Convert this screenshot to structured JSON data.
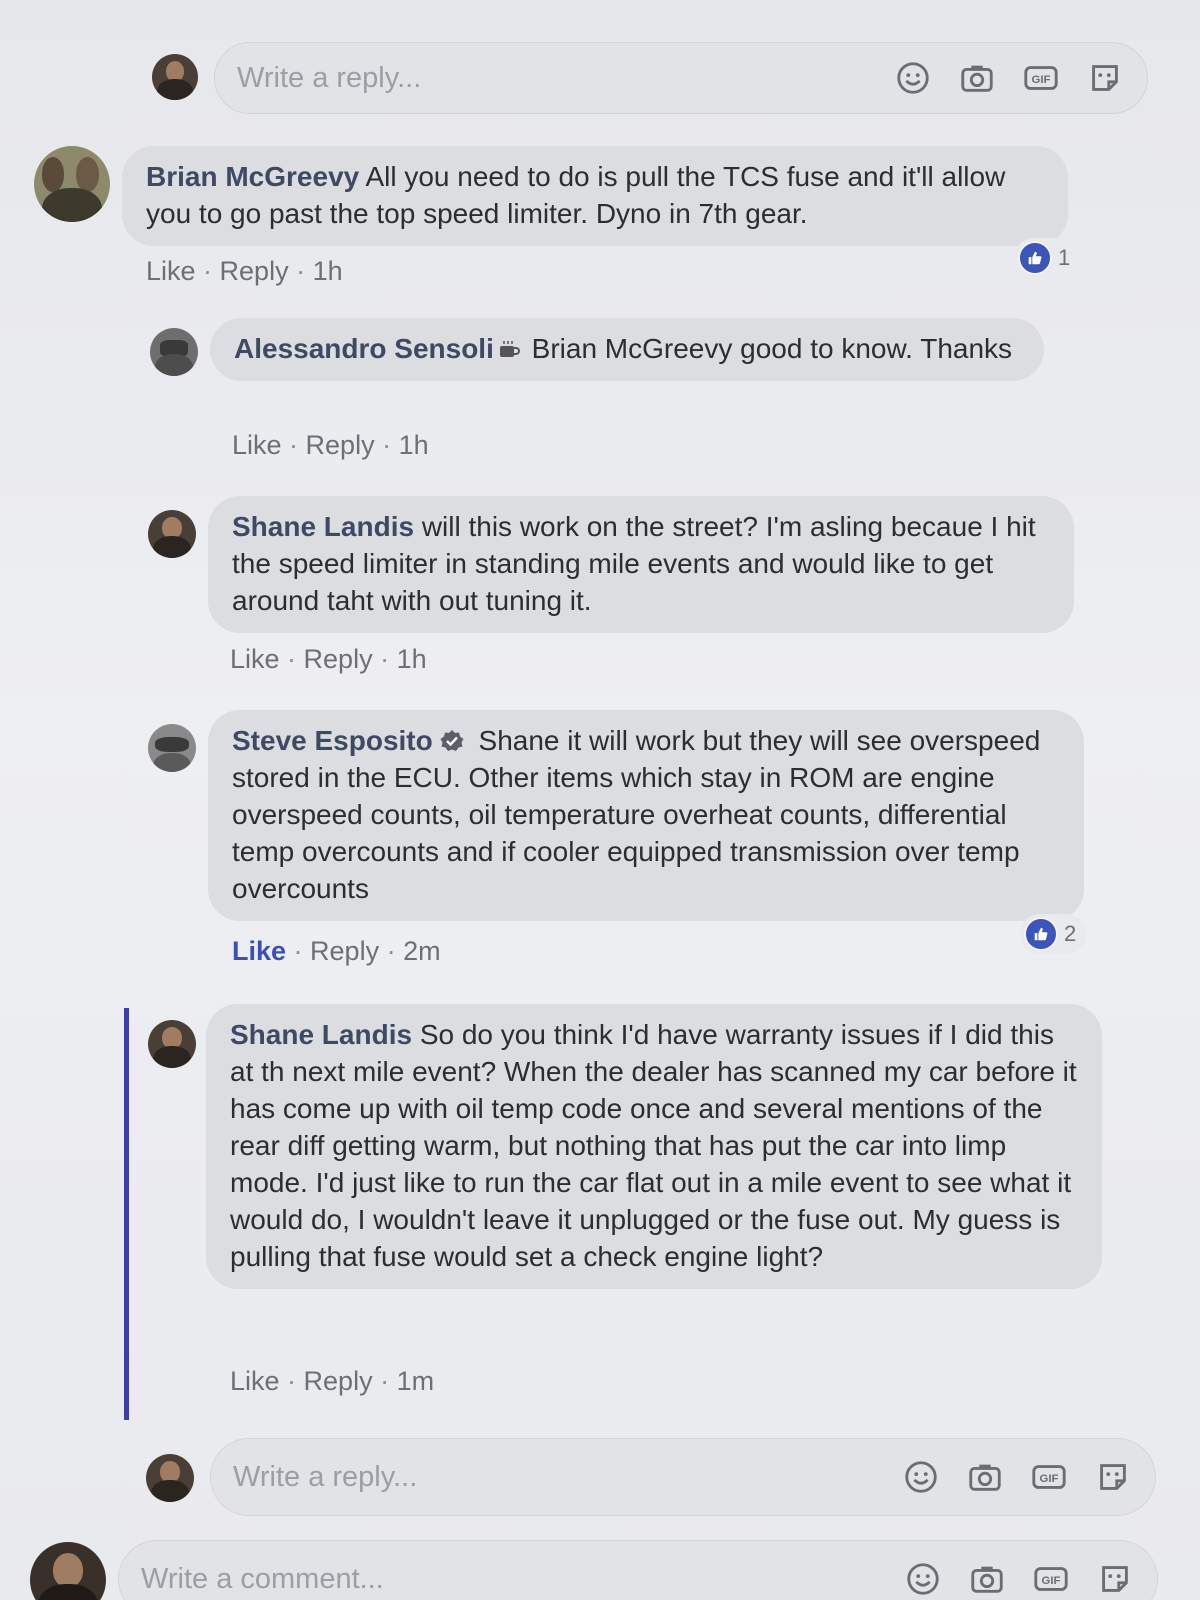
{
  "top_reply_box": {
    "placeholder": "Write a reply...",
    "icons": [
      "emoji-icon",
      "camera-icon",
      "gif-icon",
      "sticker-icon"
    ]
  },
  "comments": [
    {
      "author": "Brian McGreevy",
      "text": " All you need to do is pull the TCS fuse and it'll allow you to go past the top speed limiter. Dyno in 7th gear.",
      "like": "Like",
      "reply": "Reply",
      "time": "1h",
      "reaction_count": "1"
    },
    {
      "author": "Alessandro Sensoli",
      "text": " Brian McGreevy good to know. Thanks",
      "like": "Like",
      "reply": "Reply",
      "time": "1h"
    },
    {
      "author": "Shane Landis",
      "text": " will this work on the street? I'm asling becaue I hit the speed limiter in standing mile events and would like to get around taht with out tuning it.",
      "like": "Like",
      "reply": "Reply",
      "time": "1h"
    },
    {
      "author": "Steve Esposito",
      "text": " Shane it will work but they will see overspeed stored in the ECU. Other items which stay in ROM are engine overspeed counts, oil temperature overheat counts, differential temp overcounts and if cooler equipped transmission over temp overcounts",
      "like": "Like",
      "reply": "Reply",
      "time": "2m",
      "reaction_count": "2"
    },
    {
      "author": "Shane Landis",
      "text": " So do you think I'd have warranty issues if I did this at th next mile event? When the dealer has scanned my car before it has come up with oil temp code once and several mentions of the rear diff getting warm, but nothing that has put the car into limp mode. I'd just like to run the car flat out in a mile event to see what it would do, I wouldn't leave it unplugged or the fuse out. My guess is pulling that fuse would set a check engine light?",
      "like": "Like",
      "reply": "Reply",
      "time": "1m"
    }
  ],
  "bottom_reply_box": {
    "placeholder": "Write a reply..."
  },
  "comment_box": {
    "placeholder": "Write a comment..."
  },
  "colors": {
    "link_blue": "#3b4fb8",
    "author": "#3e4a63",
    "bubble": "#dcdde1",
    "thread_line": "#3b3fa6"
  }
}
